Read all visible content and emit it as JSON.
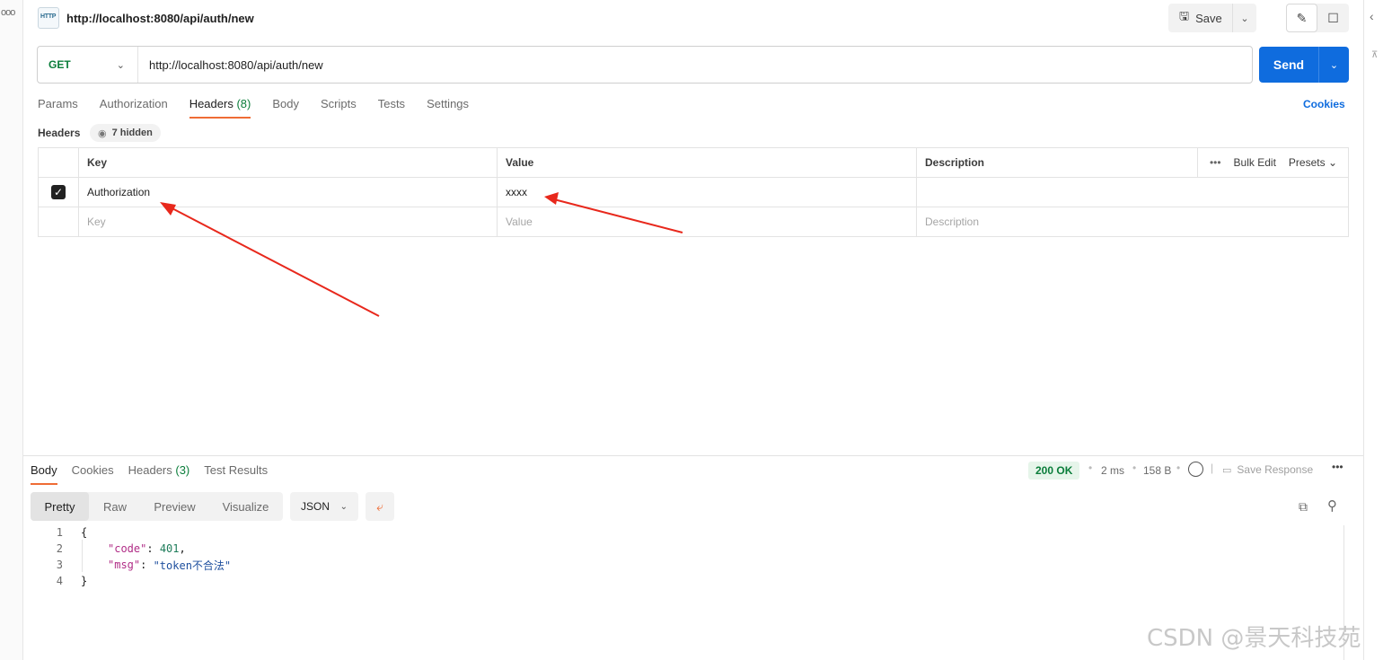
{
  "request": {
    "title": "http://localhost:8080/api/auth/new",
    "http_badge": "HTTP",
    "method": "GET",
    "url": "http://localhost:8080/api/auth/new",
    "send_label": "Send",
    "save_label": "Save"
  },
  "request_tabs": [
    {
      "label": "Params"
    },
    {
      "label": "Authorization"
    },
    {
      "label": "Headers",
      "count": "(8)",
      "active": true
    },
    {
      "label": "Body"
    },
    {
      "label": "Scripts"
    },
    {
      "label": "Tests"
    },
    {
      "label": "Settings"
    }
  ],
  "cookies_link": "Cookies",
  "headers_section": {
    "label": "Headers",
    "hidden_count": "7 hidden",
    "columns": {
      "key": "Key",
      "value": "Value",
      "description": "Description"
    },
    "bulk_edit": "Bulk Edit",
    "presets": "Presets",
    "rows": [
      {
        "checked": true,
        "key": "Authorization",
        "value": "xxxx",
        "description": ""
      }
    ],
    "placeholders": {
      "key": "Key",
      "value": "Value",
      "description": "Description"
    }
  },
  "response": {
    "tabs": [
      {
        "label": "Body",
        "active": true
      },
      {
        "label": "Cookies"
      },
      {
        "label": "Headers",
        "count": "(3)"
      },
      {
        "label": "Test Results"
      }
    ],
    "status": "200 OK",
    "time": "2 ms",
    "size": "158 B",
    "save_response": "Save Response",
    "views": [
      "Pretty",
      "Raw",
      "Preview",
      "Visualize"
    ],
    "format": "JSON",
    "body_lines": [
      {
        "n": "1",
        "text": "{"
      },
      {
        "n": "2",
        "key": "\"code\"",
        "value": "401",
        "trail": ","
      },
      {
        "n": "3",
        "key": "\"msg\"",
        "value": "\"token不合法\"",
        "trail": ""
      },
      {
        "n": "4",
        "text": "}"
      }
    ]
  },
  "watermark": "CSDN @景天科技苑",
  "colors": {
    "accent": "#ef6c35",
    "send": "#0f6cde",
    "method_get": "#0a7d3a",
    "status_ok_bg": "#e6f5ea",
    "annotation_arrow": "#e8281c"
  }
}
